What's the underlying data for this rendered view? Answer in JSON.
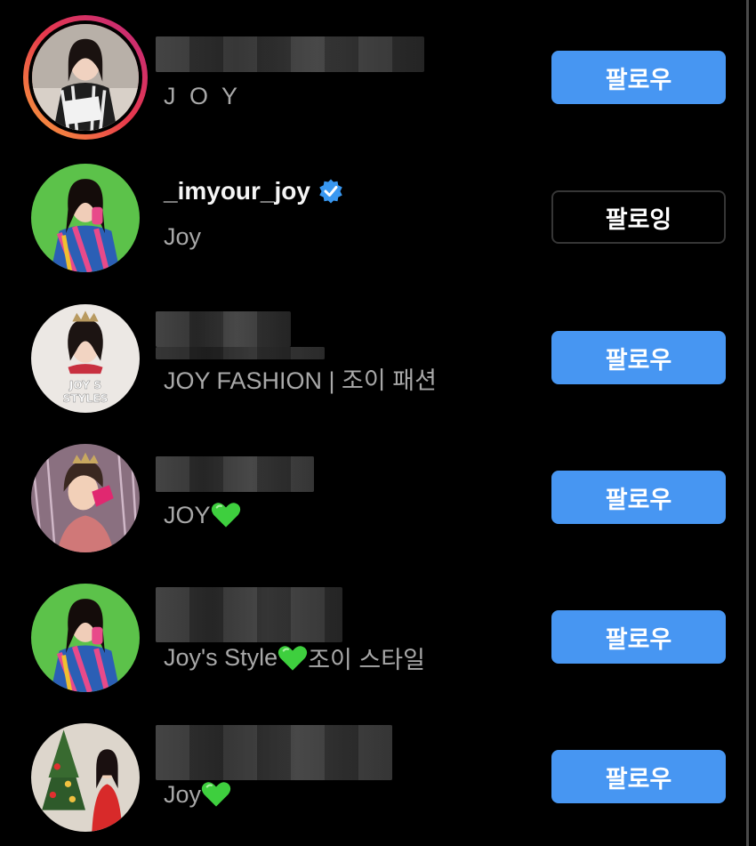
{
  "accounts": [
    {
      "username": "",
      "username_blurred": true,
      "subtitle": "J O Y",
      "subtitle_heart": false,
      "subtitle_after": "",
      "button_label": "팔로우",
      "button_state": "follow",
      "has_story_ring": true,
      "verified": false
    },
    {
      "username": "_imyour_joy",
      "username_blurred": false,
      "subtitle": "Joy",
      "subtitle_heart": false,
      "subtitle_after": "",
      "button_label": "팔로잉",
      "button_state": "following",
      "has_story_ring": false,
      "verified": true
    },
    {
      "username": "",
      "username_blurred": true,
      "subtitle": "JOY FASHION | 조이 패션",
      "subtitle_heart": false,
      "subtitle_after": "",
      "button_label": "팔로우",
      "button_state": "follow",
      "has_story_ring": false,
      "verified": false,
      "avatar_text": "JOY S STYLES"
    },
    {
      "username": "",
      "username_blurred": true,
      "subtitle": "JOY ",
      "subtitle_heart": true,
      "subtitle_after": "",
      "button_label": "팔로우",
      "button_state": "follow",
      "has_story_ring": false,
      "verified": false
    },
    {
      "username": "",
      "username_blurred": true,
      "subtitle": "Joy's Style ",
      "subtitle_heart": true,
      "subtitle_after": " 조이 스타일",
      "button_label": "팔로우",
      "button_state": "follow",
      "has_story_ring": false,
      "verified": false
    },
    {
      "username": "",
      "username_blurred": true,
      "subtitle": "Joy",
      "subtitle_heart": true,
      "subtitle_after": "",
      "button_label": "팔로우",
      "button_state": "follow",
      "has_story_ring": false,
      "verified": false
    }
  ],
  "colors": {
    "background": "#000000",
    "follow_button": "#4796f2",
    "following_border": "#363636",
    "subtitle_text": "#a8a8a8",
    "verified_badge": "#3897f0",
    "heart": "#3ecf3e"
  },
  "icons": {
    "verified": "verified-badge-icon",
    "heart": "green-heart-icon"
  }
}
